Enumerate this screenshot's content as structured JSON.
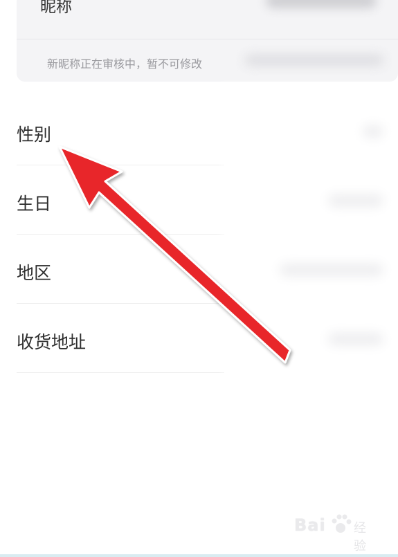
{
  "nickname": {
    "label": "昵称",
    "notice": "新昵称正在审核中，暂不可修改"
  },
  "rows": [
    {
      "label": "性别"
    },
    {
      "label": "生日"
    },
    {
      "label": "地区"
    },
    {
      "label": "收货地址"
    }
  ],
  "colors": {
    "arrow": "#e8262a",
    "card_bg": "#f4f4f6"
  },
  "watermark": {
    "brand": "Bai",
    "suffix": "经验"
  }
}
